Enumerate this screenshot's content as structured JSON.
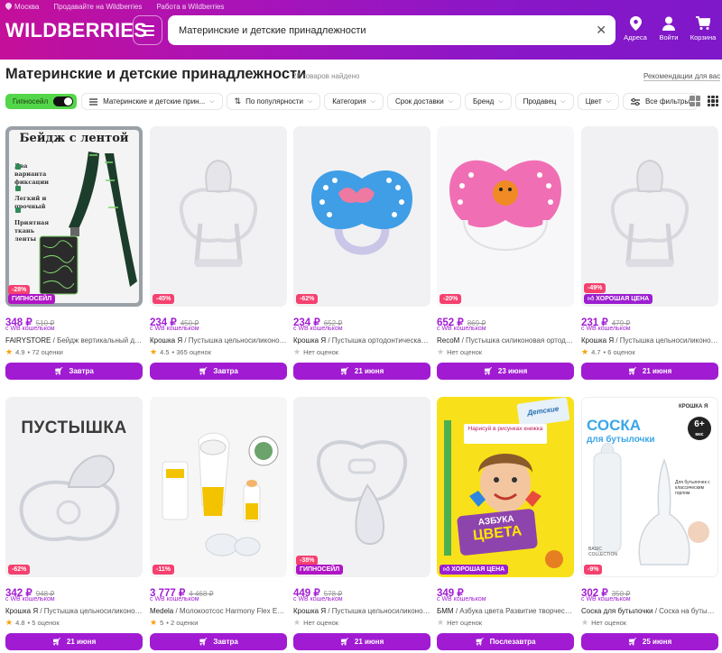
{
  "header": {
    "top_location": "Москва",
    "top_links": [
      "Продавайте на Wildberries",
      "Работа в Wildberries"
    ],
    "logo": "WILDBERRIES",
    "search_value": "Материнские и детские принадлежности",
    "icons": [
      {
        "name": "location-icon",
        "label": "Адреса"
      },
      {
        "name": "user-icon",
        "label": "Войти"
      },
      {
        "name": "cart-icon",
        "label": "Корзина"
      }
    ],
    "brand_color": "#a814b8"
  },
  "page": {
    "title": "Материнские и детские принадлежности",
    "count": "28 товаров найдено",
    "recommendations": "Рекомендации для вас"
  },
  "filters": {
    "sale_label": "Гипносейл",
    "chips": [
      "Материнские и детские прин...",
      "По популярности",
      "Категория",
      "Срок доставки",
      "Бренд",
      "Продавец",
      "Цвет",
      "Все фильтры"
    ]
  },
  "products": [
    {
      "price": "348 ₽",
      "old": "510 ₽",
      "wallet": "с WB кошельком",
      "brand": "FAIRYSTORE",
      "title": "/ Бейдж вертикальный для п...",
      "rating": "4.9",
      "reviews": "• 72 оценки",
      "delivery": "Завтра",
      "discount": "-28%",
      "badge": "ГИПНОСЕЙЛ",
      "rated": true
    },
    {
      "price": "234 ₽",
      "old": "450 ₽",
      "wallet": "с WB кошельком",
      "brand": "Крошка Я",
      "title": "/ Пустышка цельносиликоновая",
      "rating": "4.5",
      "reviews": "• 365 оценок",
      "delivery": "Завтра",
      "discount": "-45%",
      "badge": "",
      "rated": true
    },
    {
      "price": "234 ₽",
      "old": "652 ₽",
      "wallet": "с WB кошельком",
      "brand": "Крошка Я",
      "title": "/ Пустышка ортодонтическая, ...",
      "rating": "",
      "reviews": "Нет оценок",
      "delivery": "21 июня",
      "discount": "-62%",
      "badge": "",
      "rated": false
    },
    {
      "price": "652 ₽",
      "old": "869 ₽",
      "wallet": "с WB кошельком",
      "brand": "RecoM",
      "title": "/ Пустышка силиконовая ортодон...",
      "rating": "",
      "reviews": "Нет оценок",
      "delivery": "23 июня",
      "discount": "-20%",
      "badge": "",
      "rated": false
    },
    {
      "price": "231 ₽",
      "old": "479 ₽",
      "wallet": "с WB кошельком",
      "brand": "Крошка Я",
      "title": "/ Пустышка цельносиликоновая",
      "rating": "4.7",
      "reviews": "• 6 оценок",
      "delivery": "21 июня",
      "discount": "-49%",
      "badge": "ХОРОШАЯ ЦЕНА",
      "rated": true
    },
    {
      "price": "342 ₽",
      "old": "948 ₽",
      "wallet": "с WB кошельком",
      "brand": "Крошка Я",
      "title": "/ Пустышка цельносиликонов...",
      "rating": "4.8",
      "reviews": "• 5 оценок",
      "delivery": "21 июня",
      "discount": "-62%",
      "badge": "",
      "rated": true
    },
    {
      "price": "3 777 ₽",
      "old": "4 468 ₽",
      "wallet": "с WB кошельком",
      "brand": "Medela",
      "title": "/ Молокоотсос Harmony Flex Esse...",
      "rating": "5",
      "reviews": "• 2 оценки",
      "delivery": "Завтра",
      "discount": "-11%",
      "badge": "",
      "rated": true
    },
    {
      "price": "449 ₽",
      "old": "578 ₽",
      "wallet": "с WB кошельком",
      "brand": "Крошка Я",
      "title": "/ Пустышка цельносиликонов...",
      "rating": "",
      "reviews": "Нет оценок",
      "delivery": "21 июня",
      "discount": "-38%",
      "badge": "ГИПНОСЕЙЛ",
      "rated": false
    },
    {
      "price": "349 ₽",
      "old": "",
      "wallet": "с WB кошельком",
      "brand": "БММ",
      "title": "/ Азбука цвета Развитие творческ...",
      "rating": "",
      "reviews": "Нет оценок",
      "delivery": "Послезавтра",
      "discount": "",
      "badge": "ХОРОШАЯ ЦЕНА",
      "rated": false
    },
    {
      "price": "302 ₽",
      "old": "350 ₽",
      "wallet": "с WB кошельком",
      "brand": "Соска для бутылочки",
      "title": "/ Соска на бутылоч...",
      "rating": "",
      "reviews": "Нет оценок",
      "delivery": "25 июня",
      "discount": "-9%",
      "badge": "",
      "rated": false
    }
  ],
  "image_texts": {
    "badge_title": "Бейдж с лентой",
    "badge_points": [
      "Два варианта фиксации",
      "Легкий и прочный",
      "Приятная ткань ленты"
    ],
    "pacifier_word": "ПУСТЫШКА",
    "book_top": "Детские",
    "book_sub": "Нарисуй в рисунках книжка",
    "book_title1": "АЗБУКА",
    "book_title2": "ЦВЕТА",
    "nipple_title1": "СОСКА",
    "nipple_title2": "для бутылочки",
    "nipple_brand": "КРОШКА Я",
    "nipple_age": "6+",
    "nipple_age_unit": "мес",
    "nipple_note": "Для бутылочек с классическим горлом",
    "nipple_basic": "BASIC COLLECTION"
  }
}
